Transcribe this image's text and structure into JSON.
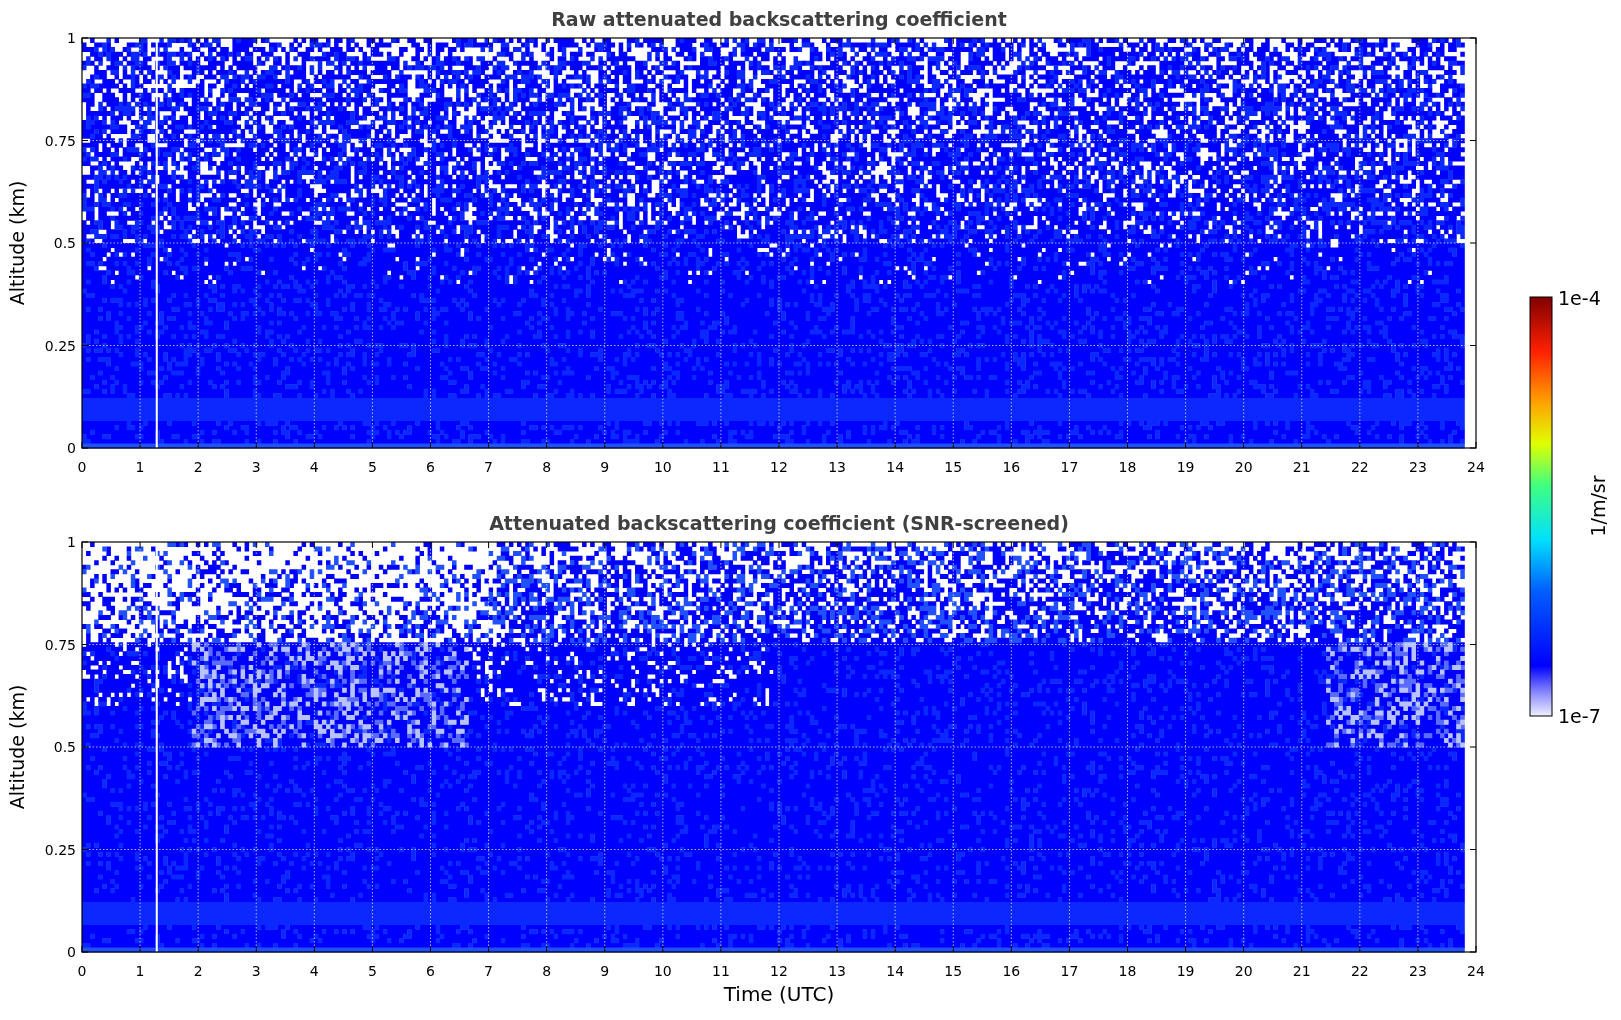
{
  "panels": [
    {
      "kind": "raw",
      "title": "Raw attenuated backscattering coefficient",
      "ylabel": "Altitude (km)",
      "yticks": [
        "1",
        "0.75",
        "0.5",
        "0.25",
        "0"
      ],
      "xticks": [
        "0",
        "1",
        "2",
        "3",
        "4",
        "5",
        "6",
        "7",
        "8",
        "9",
        "10",
        "11",
        "12",
        "13",
        "14",
        "15",
        "16",
        "17",
        "18",
        "19",
        "20",
        "21",
        "22",
        "23",
        "24"
      ]
    },
    {
      "kind": "screened",
      "title": "Attenuated backscattering coefficient (SNR-screened)",
      "ylabel": "Altitude (km)",
      "yticks": [
        "1",
        "0.75",
        "0.5",
        "0.25",
        "0"
      ],
      "xticks": [
        "0",
        "1",
        "2",
        "3",
        "4",
        "5",
        "6",
        "7",
        "8",
        "9",
        "10",
        "11",
        "12",
        "13",
        "14",
        "15",
        "16",
        "17",
        "18",
        "19",
        "20",
        "21",
        "22",
        "23",
        "24"
      ]
    }
  ],
  "xlabel": "Time (UTC)",
  "colorbar": {
    "label": "1/m/sr",
    "max": "1e-4",
    "min": "1e-7"
  }
}
